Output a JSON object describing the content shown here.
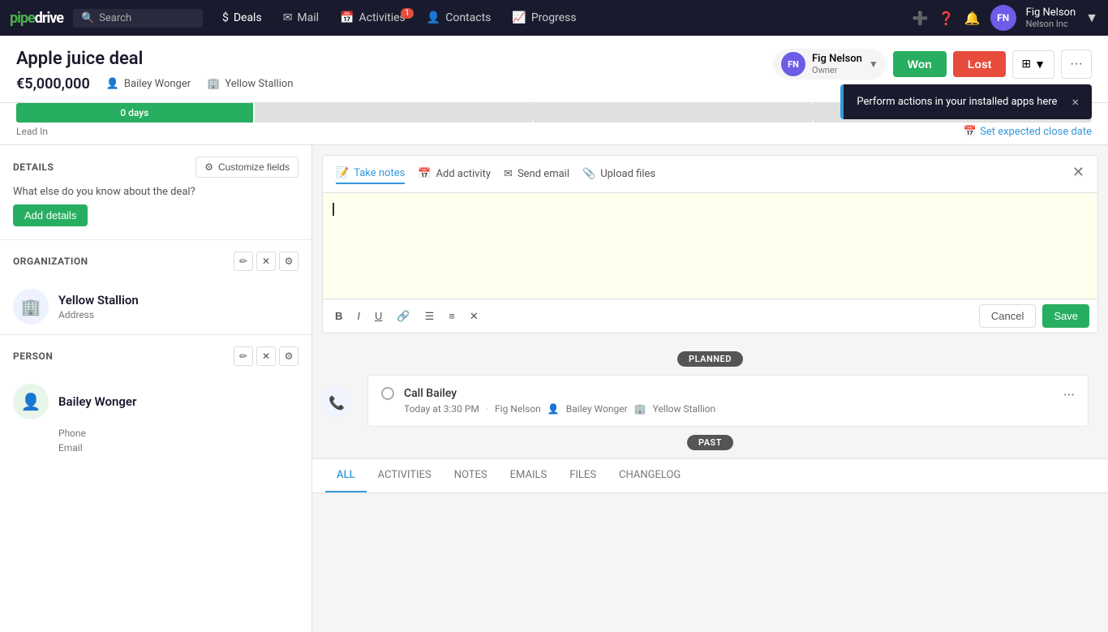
{
  "app": {
    "logo": "pipedrive",
    "logo_color": "#4caf50"
  },
  "nav": {
    "search_placeholder": "Search",
    "items": [
      {
        "id": "deals",
        "label": "Deals",
        "icon": "$",
        "active": true,
        "badge": null
      },
      {
        "id": "mail",
        "label": "Mail",
        "icon": "✉",
        "active": false,
        "badge": null
      },
      {
        "id": "activities",
        "label": "Activities",
        "icon": "📅",
        "active": false,
        "badge": "1"
      },
      {
        "id": "contacts",
        "label": "Contacts",
        "icon": "👤",
        "active": false,
        "badge": null
      },
      {
        "id": "progress",
        "label": "Progress",
        "icon": "📈",
        "active": false,
        "badge": null
      }
    ],
    "user": {
      "name": "Fig Nelson",
      "company": "Nelson Inc",
      "initials": "FN"
    }
  },
  "deal": {
    "title": "Apple juice deal",
    "amount": "€5,000,000",
    "person": "Bailey Wonger",
    "org": "Yellow Stallion",
    "owner_name": "Fig Nelson",
    "owner_label": "Owner",
    "owner_initials": "FN",
    "btn_won": "Won",
    "btn_lost": "Lost",
    "close_date_label": "Set expected close date",
    "stage_label": "Lead In",
    "days_label": "0 days"
  },
  "toast": {
    "message": "Perform actions in your installed apps here",
    "close_icon": "×"
  },
  "progress": {
    "segments": 4,
    "active_label": "0 days",
    "stage_label": "Lead In"
  },
  "left_panel": {
    "details_section": {
      "title": "DETAILS",
      "customize_btn": "Customize fields",
      "question": "What else do you know about the deal?",
      "add_btn": "Add details"
    },
    "org_section": {
      "title": "ORGANIZATION",
      "name": "Yellow Stallion",
      "sub_label": "Address",
      "icon": "🏢"
    },
    "person_section": {
      "title": "PERSON",
      "name": "Bailey Wonger",
      "phone_label": "Phone",
      "email_label": "Email",
      "icon": "👤"
    }
  },
  "right_panel": {
    "tabs": [
      {
        "id": "take_notes",
        "label": "Take notes",
        "icon": "📝",
        "active": true
      },
      {
        "id": "add_activity",
        "label": "Add activity",
        "icon": "📅",
        "active": false
      },
      {
        "id": "send_email",
        "label": "Send email",
        "icon": "✉",
        "active": false
      },
      {
        "id": "upload_files",
        "label": "Upload files",
        "icon": "📎",
        "active": false
      }
    ],
    "editor_placeholder": "",
    "editor_toolbar": {
      "bold": "B",
      "italic": "I",
      "underline": "U",
      "link": "🔗",
      "ul": "☰",
      "ol": "#",
      "clear": "✕"
    },
    "cancel_btn": "Cancel",
    "save_btn": "Save",
    "planned_badge": "PLANNED",
    "past_badge": "PAST",
    "activity": {
      "title": "Call Bailey",
      "time": "Today at 3:30 PM",
      "owner": "Fig Nelson",
      "person": "Bailey Wonger",
      "org": "Yellow Stallion"
    },
    "bottom_tabs": [
      {
        "id": "all",
        "label": "ALL",
        "active": true
      },
      {
        "id": "activities",
        "label": "ACTIVITIES",
        "active": false
      },
      {
        "id": "notes",
        "label": "NOTES",
        "active": false
      },
      {
        "id": "emails",
        "label": "EMAILS",
        "active": false
      },
      {
        "id": "files",
        "label": "FILES",
        "active": false
      },
      {
        "id": "changelog",
        "label": "CHANGELOG",
        "active": false
      }
    ]
  }
}
